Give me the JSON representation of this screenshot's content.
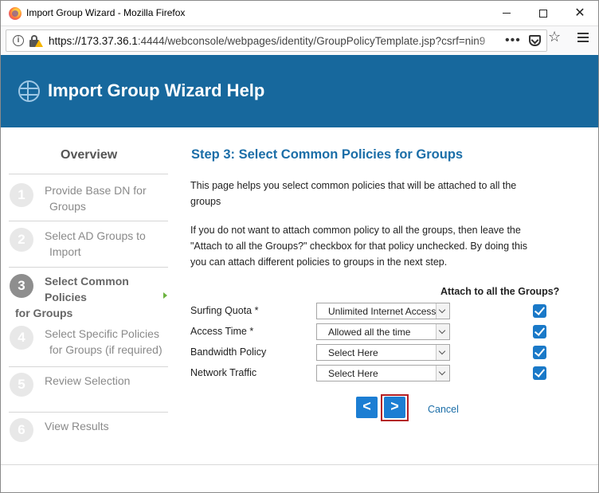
{
  "window": {
    "title": "Import Group Wizard - Mozilla Firefox"
  },
  "browser": {
    "url_host": "https://173.37.36.1",
    "url_rest": ":4444/webconsole/webpages/identity/GroupPolicyTemplate.jsp?csrf=nin9",
    "more_label": "•••",
    "star_label": "☆"
  },
  "header": {
    "title": "Import Group Wizard Help"
  },
  "sidebar": {
    "overview": "Overview",
    "steps": [
      {
        "num": "1",
        "line1": "Provide Base DN for",
        "line2": "Groups"
      },
      {
        "num": "2",
        "line1": "Select AD Groups to",
        "line2": "Import"
      },
      {
        "num": "3",
        "line1": "Select Common",
        "line2": "Policies",
        "line3": "for Groups"
      },
      {
        "num": "4",
        "line1": "Select Specific Policies",
        "line2": "for Groups (if required)"
      },
      {
        "num": "5",
        "line1": "Review Selection"
      },
      {
        "num": "6",
        "line1": "View Results"
      }
    ]
  },
  "main": {
    "title": "Step 3: Select Common Policies for Groups",
    "para1_line1": "This page helps you select common policies that will be attached to all the",
    "para1_line2": "groups",
    "para2_line1": "If you do not want to attach common policy to all the groups, then leave the",
    "para2_line2": "\"Attach to all the Groups?\" checkbox for that policy unchecked. By doing this",
    "para2_line3": "you can attach different policies to groups in the next step.",
    "attach_header": "Attach to all the Groups?",
    "policies": [
      {
        "label": "Surfing Quota *",
        "value": "Unlimited Internet Access",
        "attach": true
      },
      {
        "label": "Access Time *",
        "value": "Allowed all the time",
        "attach": true
      },
      {
        "label": "Bandwidth Policy",
        "value": "Select Here",
        "attach": true
      },
      {
        "label": "Network Traffic",
        "value": "Select Here",
        "attach": true
      }
    ],
    "prev_label": "<",
    "next_label": ">",
    "cancel_label": "Cancel"
  }
}
